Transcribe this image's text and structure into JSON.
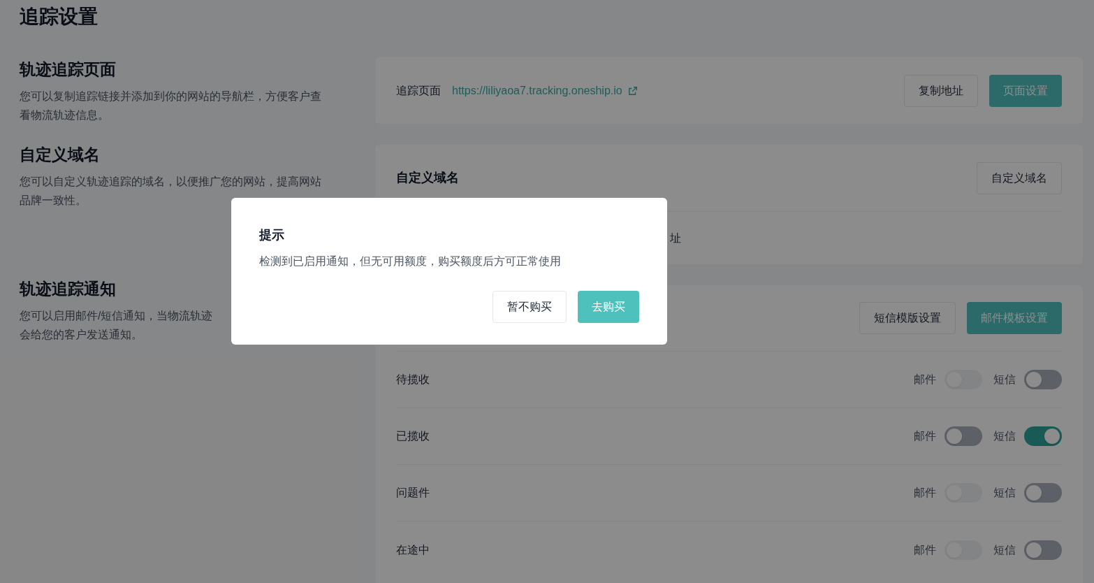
{
  "page_title": "追踪设置",
  "sections": [
    {
      "title": "轨迹追踪页面",
      "lines": [
        "您可以复制追踪链接并添加到你的网站的导航栏，方便客户查",
        "看物流轨迹信息。"
      ]
    },
    {
      "title": "自定义域名",
      "lines": [
        "您可以自定义轨迹追踪的域名，以便推广您的网站，提高网站",
        "品牌一致性。"
      ]
    },
    {
      "title": "轨迹追踪通知",
      "lines": [
        "您可以启用邮件/短信通知，当物流轨迹",
        "会给您的客户发送通知。"
      ]
    }
  ],
  "tracking_page": {
    "label": "追踪页面",
    "url": "https://liliyaoa7.tracking.oneship.io",
    "buttons": [
      {
        "label": "复制地址",
        "kind": "secondary"
      },
      {
        "label": "页面设置",
        "kind": "primary"
      }
    ]
  },
  "custom_domain": {
    "title": "自定义域名",
    "button": {
      "label": "自定义域名"
    },
    "row_fragment": "址"
  },
  "notifications": {
    "buttons": [
      {
        "label": "短信模版设置",
        "kind": "secondary"
      },
      {
        "label": "邮件模板设置",
        "kind": "primary"
      }
    ],
    "rows": [
      {
        "label": "待揽收",
        "email": {
          "label": "邮件",
          "on": false,
          "disabled": true
        },
        "sms": {
          "label": "短信",
          "on": false
        }
      },
      {
        "label": "已揽收",
        "email": {
          "label": "邮件",
          "on": false,
          "disabled": false
        },
        "sms": {
          "label": "短信",
          "on": true
        }
      },
      {
        "label": "问题件",
        "email": {
          "label": "邮件",
          "on": false,
          "disabled": true
        },
        "sms": {
          "label": "短信",
          "on": false
        }
      },
      {
        "label": "在途中",
        "email": {
          "label": "邮件",
          "on": false,
          "disabled": true
        },
        "sms": {
          "label": "短信",
          "on": false
        }
      }
    ]
  },
  "dialog": {
    "title": "提示",
    "message": "检测到已启用通知，但无可用额度，购买额度后方可正常使用",
    "buttons": [
      {
        "label": "暂不购买",
        "kind": "secondary"
      },
      {
        "label": "去购买",
        "kind": "primary"
      }
    ]
  }
}
